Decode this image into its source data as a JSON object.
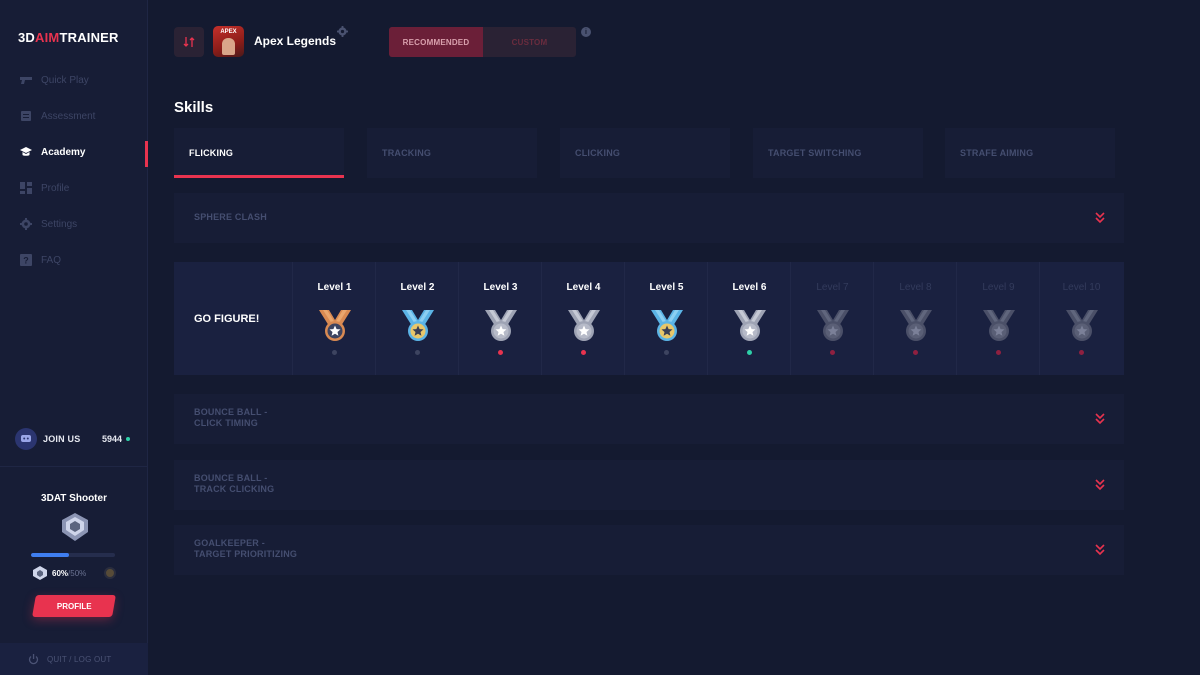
{
  "app": {
    "logo_pre": "3D",
    "logo_mid": "AIM",
    "logo_post": "TRAINER"
  },
  "sidebar": {
    "items": [
      {
        "label": "Quick Play",
        "icon": "gun-icon",
        "active": false
      },
      {
        "label": "Assessment",
        "icon": "clipboard-icon",
        "active": false
      },
      {
        "label": "Academy",
        "icon": "graduation-cap-icon",
        "active": true
      },
      {
        "label": "Profile",
        "icon": "dashboard-icon",
        "active": false
      },
      {
        "label": "Settings",
        "icon": "gear-icon",
        "active": false
      },
      {
        "label": "FAQ",
        "icon": "question-icon",
        "active": false
      }
    ],
    "join_label": "JOIN US",
    "join_count": "5944",
    "rank_title": "3DAT Shooter",
    "rank_progress": 0.45,
    "percent_current": "60%",
    "percent_sep": "/50%",
    "profile_button": "PROFILE",
    "quit_label": "QUIT / LOG OUT"
  },
  "header": {
    "game_name": "Apex Legends",
    "game_icon_text": "APEX",
    "toggle": {
      "recommended": "RECOMMENDED",
      "custom": "CUSTOM"
    },
    "info_icon": "i"
  },
  "skills_title": "Skills",
  "tabs": [
    "FLICKING",
    "TRACKING",
    "CLICKING",
    "TARGET SWITCHING",
    "STRAFE AIMING"
  ],
  "exercises": {
    "sphere_clash": "SPHERE CLASH",
    "go_figure": "GO FIGURE!",
    "bounce_click": "BOUNCE BALL -\nCLICK TIMING",
    "bounce_track": "BOUNCE BALL -\nTRACK CLICKING",
    "goalkeeper": "GOALKEEPER -\nTARGET PRIORITIZING"
  },
  "levels": [
    {
      "name": "Level 1",
      "medal": "bronze",
      "status": "grey",
      "locked": false
    },
    {
      "name": "Level 2",
      "medal": "blue",
      "status": "grey",
      "locked": false
    },
    {
      "name": "Level 3",
      "medal": "silver",
      "status": "red",
      "locked": false
    },
    {
      "name": "Level 4",
      "medal": "silver",
      "status": "red",
      "locked": false
    },
    {
      "name": "Level 5",
      "medal": "blue",
      "status": "grey",
      "locked": false
    },
    {
      "name": "Level 6",
      "medal": "silver",
      "status": "teal",
      "locked": false
    },
    {
      "name": "Level 7",
      "medal": "locked",
      "status": "darkred",
      "locked": true
    },
    {
      "name": "Level 8",
      "medal": "locked",
      "status": "darkred",
      "locked": true
    },
    {
      "name": "Level 9",
      "medal": "locked",
      "status": "darkred",
      "locked": true
    },
    {
      "name": "Level 10",
      "medal": "locked",
      "status": "darkred",
      "locked": true
    }
  ],
  "colors": {
    "accent": "#e8334f",
    "background": "#141a30",
    "panel": "#171d36",
    "status_grey": "#3d4460",
    "status_red": "#e8334f",
    "status_teal": "#2ed0a8",
    "status_darkred": "#8f2040"
  }
}
